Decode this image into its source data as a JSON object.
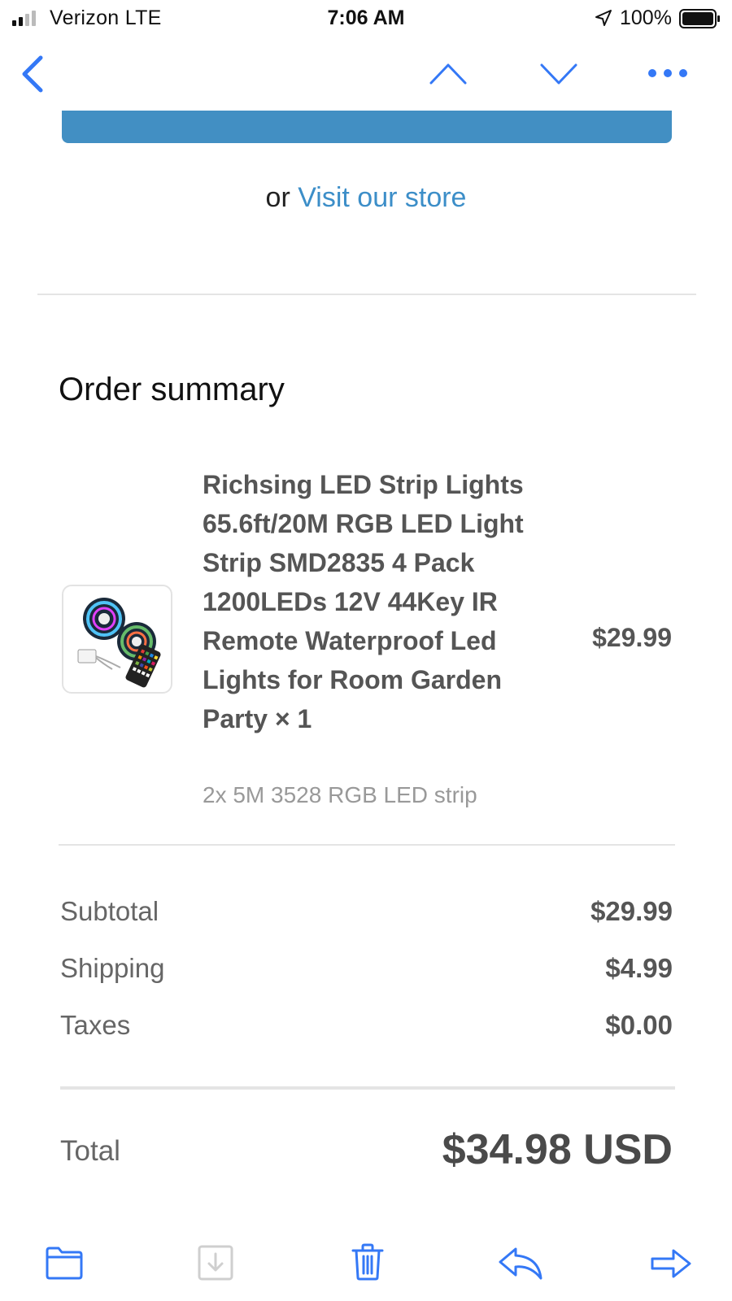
{
  "status_bar": {
    "carrier": "Verizon  LTE",
    "time": "7:06 AM",
    "battery": "100%"
  },
  "nav": {
    "icons": [
      "chevron-left-icon",
      "chevron-up-icon",
      "chevron-down-icon",
      "more-icon"
    ]
  },
  "email": {
    "store_prefix": "or ",
    "store_link": "Visit our store",
    "order_summary_title": "Order summary",
    "item": {
      "name": "Richsing LED Strip Lights 65.6ft/20M RGB LED Light Strip SMD2835 4 Pack 1200LEDs 12V 44Key IR Remote Waterproof Led Lights for Room Garden Party × 1",
      "variant": "2x 5M 3528 RGB LED strip",
      "price": "$29.99"
    },
    "costs": [
      {
        "label": "Subtotal",
        "value": "$29.99"
      },
      {
        "label": "Shipping",
        "value": "$4.99"
      },
      {
        "label": "Taxes",
        "value": "$0.00"
      }
    ],
    "total_label": "Total",
    "total_value": "$34.98 USD"
  },
  "toolbar": {
    "icons": [
      "folder-icon",
      "archive-icon",
      "trash-icon",
      "reply-icon",
      "forward-icon"
    ]
  },
  "colors": {
    "accent": "#3c8ec8",
    "cta": "#428fc3",
    "ios_blue": "#3478f6"
  }
}
